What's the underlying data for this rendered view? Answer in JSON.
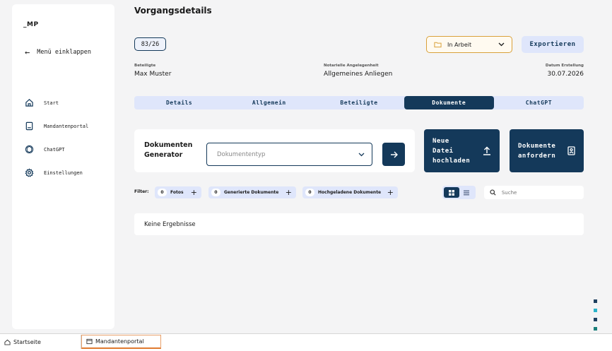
{
  "sidebar": {
    "logo": "_MP",
    "collapse_label": "Menü einklappen",
    "items": [
      {
        "label": "Start",
        "icon": "home-icon"
      },
      {
        "label": "Mandantenportal",
        "icon": "book-icon"
      },
      {
        "label": "ChatGPT",
        "icon": "openai-icon"
      },
      {
        "label": "Einstellungen",
        "icon": "gear-icon"
      }
    ]
  },
  "header": {
    "title": "Vorgangsdetails",
    "case_number": "83/26",
    "status": "In Arbeit",
    "export_label": "Exportieren"
  },
  "meta": {
    "participants_label": "Beteiligte",
    "participants_value": "Max Muster",
    "matter_label": "Notarielle Angelegenheit",
    "matter_value": "Allgemeines Anliegen",
    "date_label": "Datum Erstellung",
    "date_value": "30.07.2026"
  },
  "tabs": [
    {
      "label": "Details",
      "active": false
    },
    {
      "label": "Allgemein",
      "active": false
    },
    {
      "label": "Beteiligte",
      "active": false
    },
    {
      "label": "Dokumente",
      "active": true
    },
    {
      "label": "ChatGPT",
      "active": false
    }
  ],
  "generator": {
    "title_line1": "Dokumenten",
    "title_line2": "Generator",
    "select_placeholder": "Dokumententyp"
  },
  "upload_button": {
    "line1": "Neue",
    "line2": "Datei",
    "line3": "hochladen"
  },
  "request_button": {
    "line1": "Dokumente",
    "line2": "anfordern"
  },
  "filter": {
    "label": "Filter:",
    "chips": [
      {
        "count": "0",
        "label": "Fotos"
      },
      {
        "count": "0",
        "label": "Generierte Dokumente"
      },
      {
        "count": "0",
        "label": "Hochgeladene Dokumente"
      }
    ]
  },
  "search": {
    "placeholder": "Suche"
  },
  "results": {
    "empty_text": "Keine Ergebnisse"
  },
  "colors": {
    "primary": "#14395a",
    "tab_bg": "#dfe6fb",
    "status_border": "#d9a13a",
    "dot_dark": "#1f4060",
    "dot_cyan": "#2bb3c9",
    "dot_teal": "#1a7f7a"
  },
  "taskbar": {
    "items": [
      {
        "label": "Startseite",
        "icon": "home-icon",
        "active": false
      },
      {
        "label": "Mandantenportal",
        "icon": "portal-icon",
        "active": true
      }
    ]
  }
}
